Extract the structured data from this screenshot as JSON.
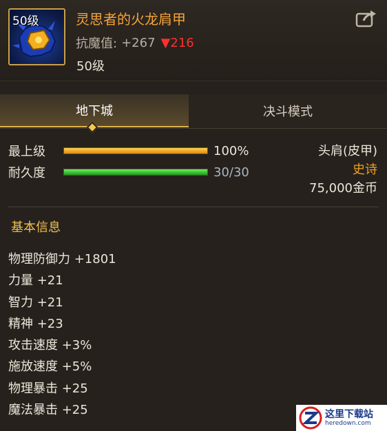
{
  "item": {
    "icon_level": "50级",
    "name": "灵思者的火龙肩甲",
    "stat_label": "抗魔值:",
    "stat_value": "+267",
    "stat_diff": "▼216",
    "level": "50级",
    "icon": "dragon-shoulder-armor-icon"
  },
  "tabs": [
    {
      "label": "地下城",
      "active": true
    },
    {
      "label": "决斗模式",
      "active": false
    }
  ],
  "bars": {
    "max_level": {
      "label": "最上级",
      "value": "100%",
      "fraction": 1.0
    },
    "durability": {
      "label": "耐久度",
      "value": "30/30",
      "fraction": 1.0
    }
  },
  "info": {
    "slot": "头肩(皮甲)",
    "rarity": "史诗",
    "price": "75,000金币"
  },
  "section_title": "基本信息",
  "attributes": [
    "物理防御力 +1801",
    "力量 +21",
    "智力 +21",
    "精神 +23",
    "攻击速度 +3%",
    "施放速度 +5%",
    "物理暴击 +25",
    "魔法暴击 +25"
  ],
  "watermark": {
    "cn": "这里下载站",
    "en": "heredown.com"
  },
  "colors": {
    "title": "#f4a33a",
    "rarity": "#f0a020",
    "down": "#ff3030",
    "accent": "#e0b24a"
  }
}
